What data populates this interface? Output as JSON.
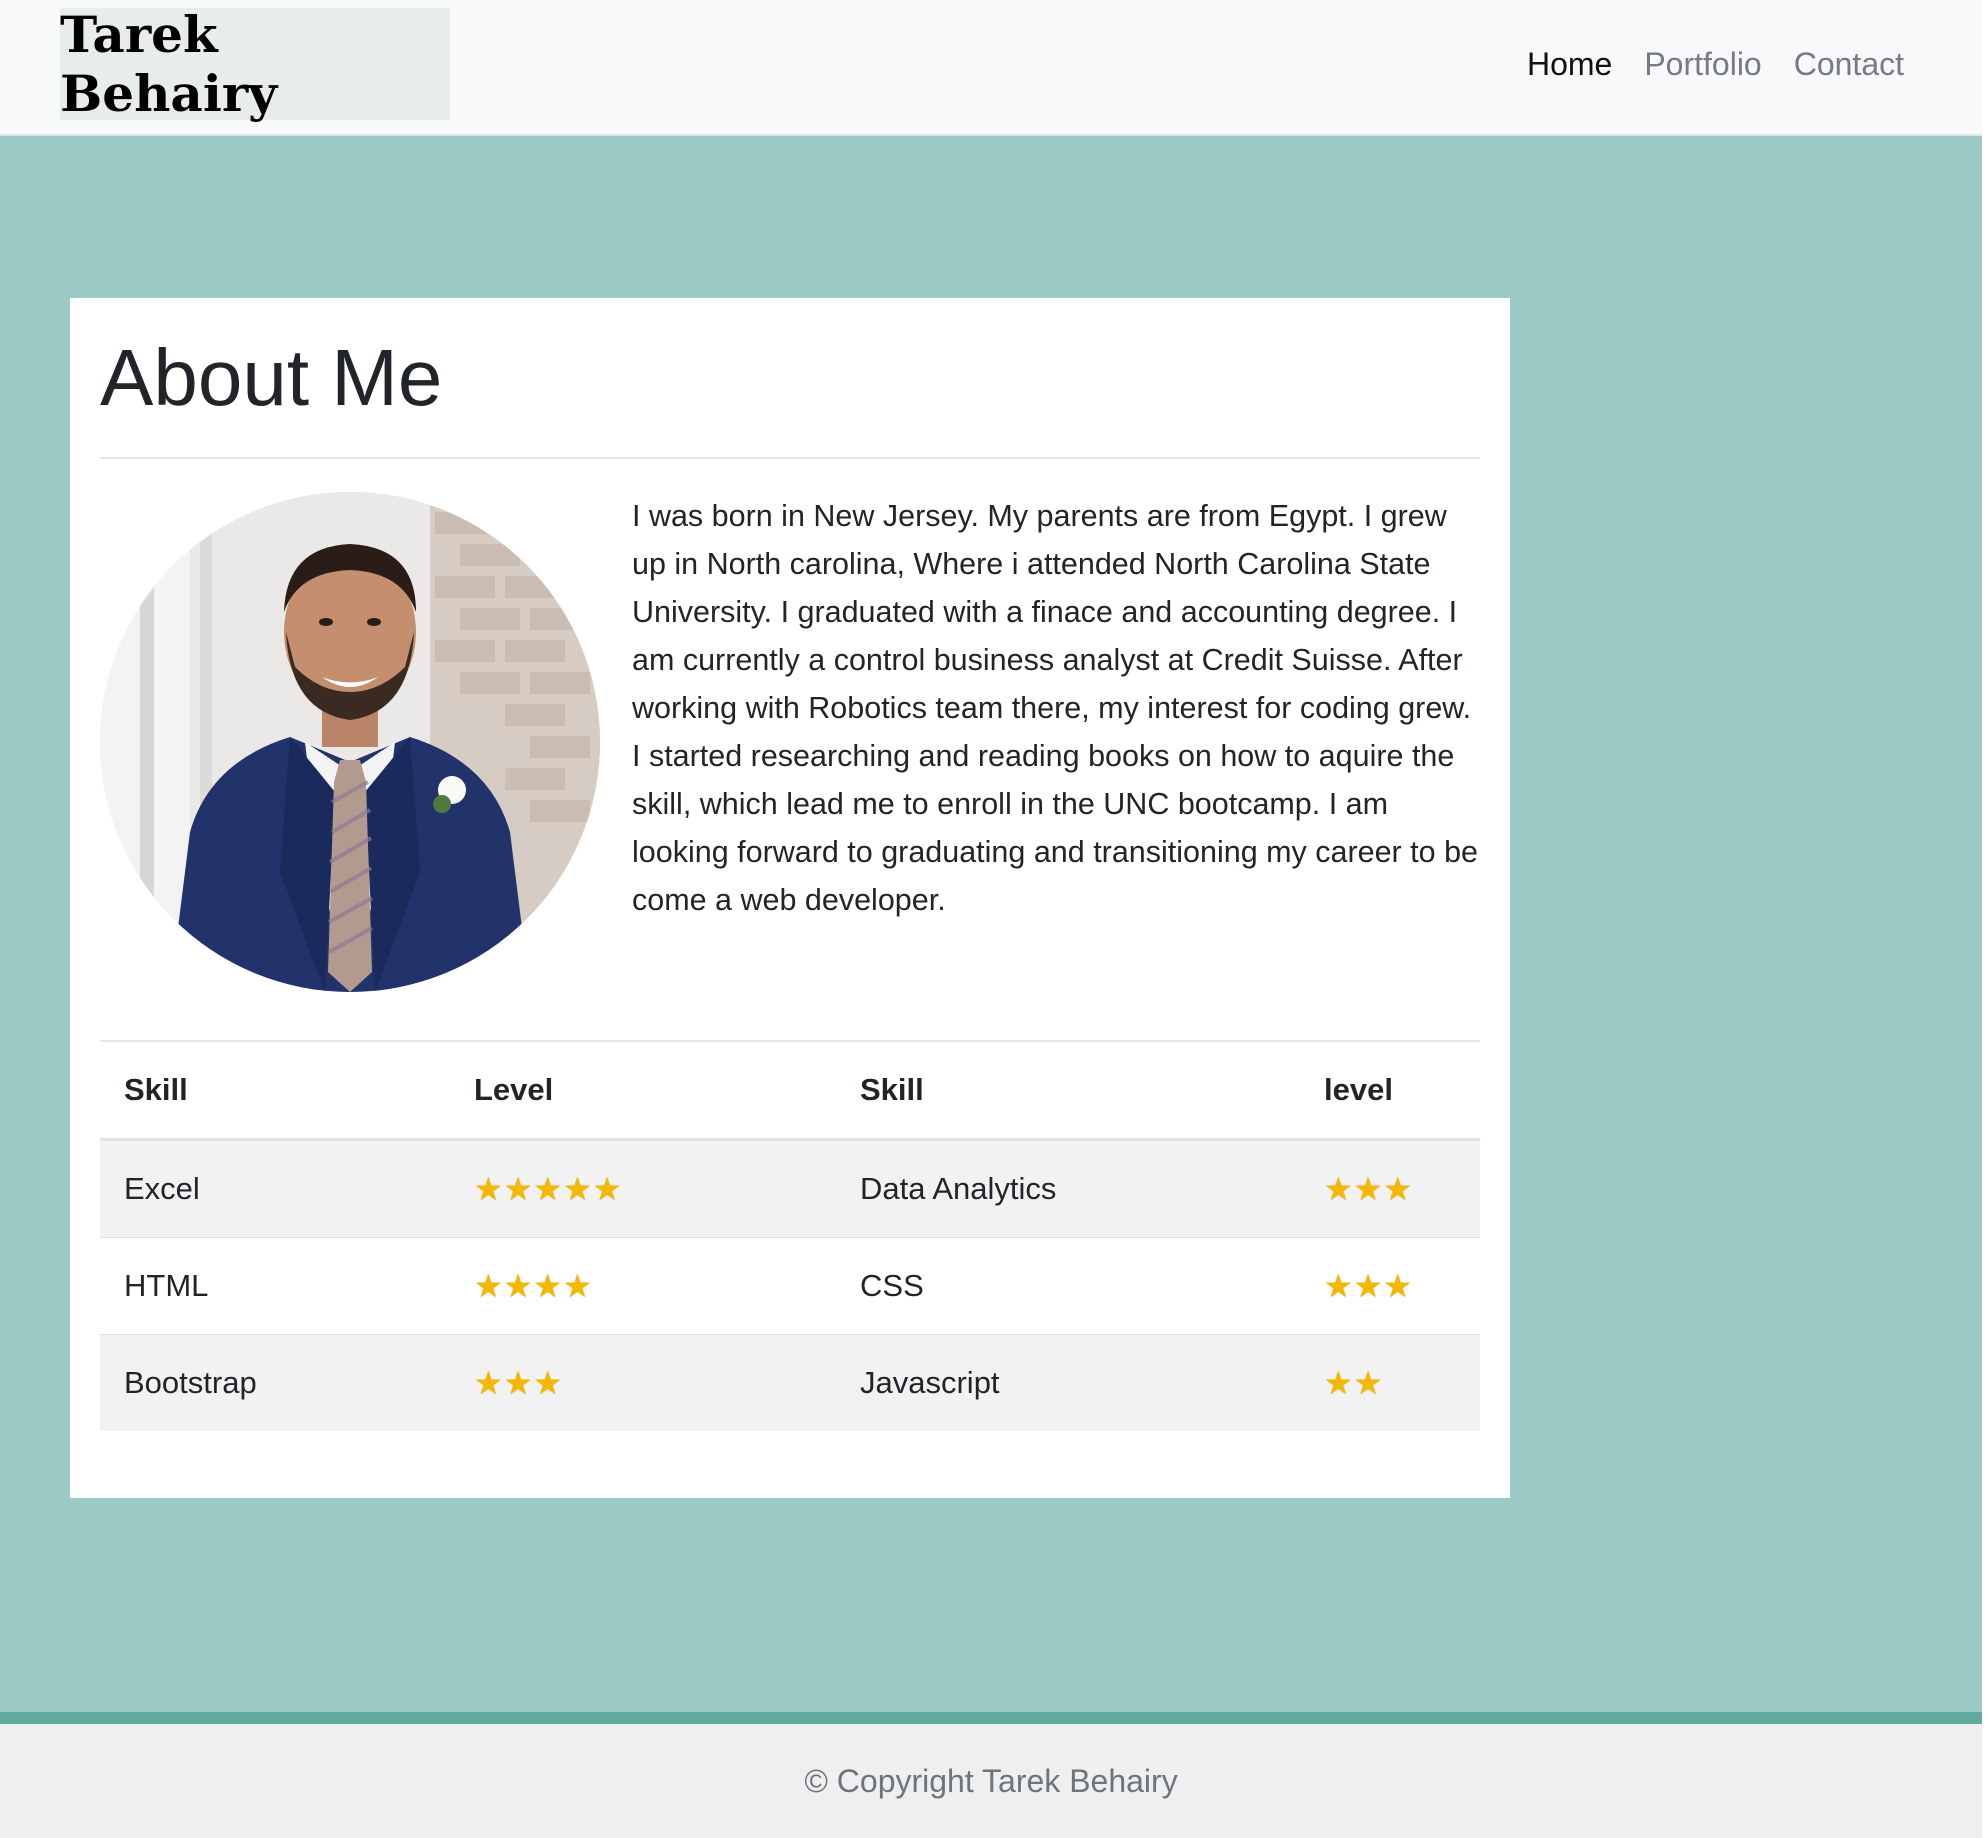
{
  "navbar": {
    "brand": "Tarek Behairy",
    "links": [
      "Home",
      "Portfolio",
      "Contact"
    ]
  },
  "about": {
    "title": "About Me",
    "photo_alt": "Portrait of Tarek Behairy in a navy suit",
    "bio": "I was born in New Jersey. My parents are from Egypt. I grew up in North carolina, Where i attended North Carolina State University. I graduated with a finace and accounting degree. I am currently a control business analyst at Credit Suisse. After working with Robotics team there, my interest for coding grew. I started researching and reading books on how to aquire the skill, which lead me to enroll in the UNC bootcamp. I am looking forward to graduating and transitioning my career to be come a web developer."
  },
  "skills": {
    "headers": [
      "Skill",
      "Level",
      "Skill",
      "level"
    ],
    "rows": [
      {
        "skill1": "Excel",
        "level1": "★★★★★",
        "skill2": "Data Analytics",
        "level2": "★★★"
      },
      {
        "skill1": "HTML",
        "level1": "★★★★",
        "skill2": "CSS",
        "level2": "★★★"
      },
      {
        "skill1": "Bootstrap",
        "level1": "★★★",
        "skill2": "Javascript",
        "level2": "★★"
      }
    ]
  },
  "footer": {
    "text": "© Copyright Tarek Behairy"
  },
  "colors": {
    "page_bg": "#9ccbc7",
    "footer_accent": "#62a9a2",
    "navbar_bg": "#f8f9fa"
  }
}
